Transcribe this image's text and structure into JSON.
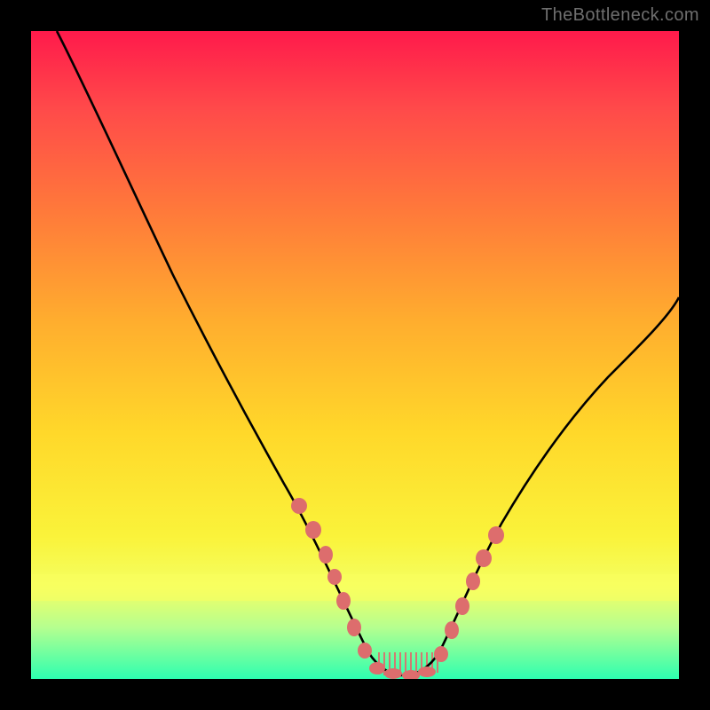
{
  "watermark": "TheBottleneck.com",
  "chart_data": {
    "type": "line",
    "title": "",
    "xlabel": "",
    "ylabel": "",
    "xlim": [
      0,
      100
    ],
    "ylim": [
      0,
      100
    ],
    "grid": false,
    "series": [
      {
        "name": "curve",
        "x": [
          4,
          8,
          12,
          16,
          20,
          24,
          28,
          32,
          36,
          40,
          44,
          48,
          50,
          52,
          54,
          56,
          58,
          60,
          62,
          64,
          68,
          72,
          76,
          80,
          84,
          88,
          92,
          96,
          100
        ],
        "y": [
          100,
          93,
          86,
          79,
          72,
          65,
          58,
          51,
          44,
          37,
          30,
          20,
          12,
          6,
          3,
          1,
          0.5,
          1,
          3,
          7,
          15,
          23,
          30,
          36,
          42,
          48,
          53,
          58,
          63
        ]
      }
    ],
    "annotations": {
      "bead_cluster_left": {
        "x_range": [
          41,
          53
        ],
        "approx_y": [
          28,
          4
        ]
      },
      "bead_cluster_right": {
        "x_range": [
          63,
          69
        ],
        "approx_y": [
          7,
          17
        ]
      },
      "bead_color": "#dd6d6d",
      "curve_near_bottom_fringe": {
        "x_range": [
          52,
          63
        ],
        "color_hint": "short vertical pink hatch"
      }
    },
    "background_gradient_stops": [
      {
        "pct": 0,
        "color": "#ff1a4b"
      },
      {
        "pct": 12,
        "color": "#ff4a4a"
      },
      {
        "pct": 28,
        "color": "#ff7a3a"
      },
      {
        "pct": 45,
        "color": "#ffae2e"
      },
      {
        "pct": 62,
        "color": "#ffd82a"
      },
      {
        "pct": 78,
        "color": "#faf33a"
      },
      {
        "pct": 86,
        "color": "#f4ff63"
      },
      {
        "pct": 92,
        "color": "#b6ff8f"
      },
      {
        "pct": 100,
        "color": "#2dffb0"
      }
    ]
  }
}
